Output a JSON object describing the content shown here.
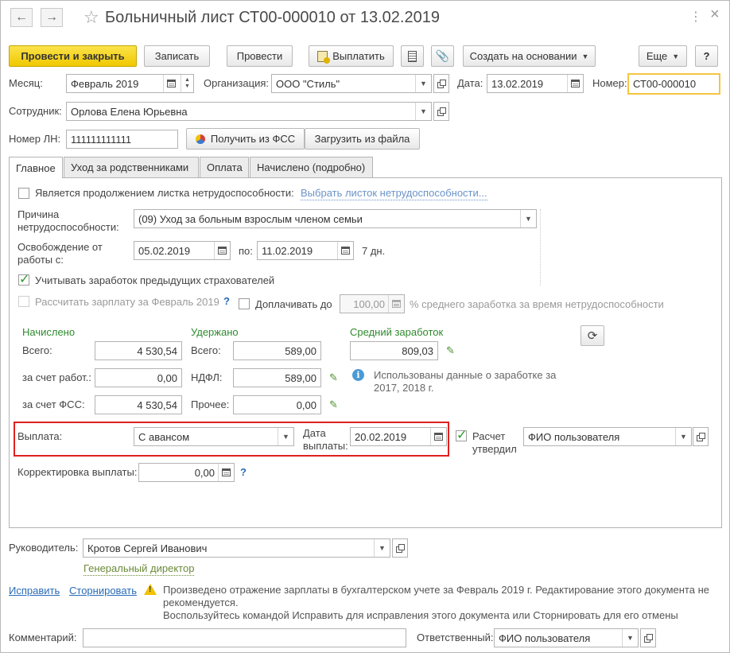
{
  "title": {
    "back": "←",
    "forward": "→",
    "star": "☆",
    "text": "Больничный лист СТ00-000010 от 13.02.2019",
    "more": "⋮",
    "close": "×"
  },
  "toolbar": {
    "post_close": "Провести и закрыть",
    "write": "Записать",
    "post": "Провести",
    "pay": "Выплатить",
    "create_based": "Создать на основании",
    "more": "Еще",
    "help": "?"
  },
  "header": {
    "month_label": "Месяц:",
    "month_value": "Февраль 2019",
    "org_label": "Организация:",
    "org_value": "ООО \"Стиль\"",
    "date_label": "Дата:",
    "date_value": "13.02.2019",
    "number_label": "Номер:",
    "number_value": "СТ00-000010",
    "employee_label": "Сотрудник:",
    "employee_value": "Орлова Елена Юрьевна",
    "ln_label": "Номер ЛН:",
    "ln_value": "111111111111",
    "get_fss": "Получить из ФСС",
    "load_file": "Загрузить из файла"
  },
  "tabs": [
    {
      "label": "Главное",
      "active": true
    },
    {
      "label": "Уход за родственниками",
      "active": false
    },
    {
      "label": "Оплата",
      "active": false
    },
    {
      "label": "Начислено (подробно)",
      "active": false
    }
  ],
  "main": {
    "continuation_label": "Является продолжением листка нетрудоспособности:",
    "continuation_checked": false,
    "choose_sheet_link": "Выбрать листок нетрудоспособности...",
    "reason_label_1": "Причина",
    "reason_label_2": "нетрудоспособности:",
    "reason_value": "(09) Уход за больным взрослым членом семьи",
    "release_label_1": "Освобождение от",
    "release_label_2": "работы с:",
    "release_from": "05.02.2019",
    "release_to_label": "по:",
    "release_to": "11.02.2019",
    "days": "7 дн.",
    "prev_insurers_label": "Учитывать заработок предыдущих страхователей",
    "prev_insurers_checked": true,
    "calc_salary_label": "Рассчитать зарплату за Февраль 2019",
    "calc_salary_checked": false,
    "calc_salary_q": "?",
    "surcharge_label": "Доплачивать до",
    "surcharge_checked": false,
    "surcharge_value": "100,00",
    "surcharge_suffix": "% среднего заработка за время нетрудоспособности"
  },
  "accrued": {
    "header": "Начислено",
    "total_label": "Всего:",
    "total": "4 530,54",
    "employer_label": "за счет работ.:",
    "employer": "0,00",
    "fss_label": "за счет ФСС:",
    "fss": "4 530,54"
  },
  "withheld": {
    "header": "Удержано",
    "total_label": "Всего:",
    "total": "589,00",
    "ndfl_label": "НДФЛ:",
    "ndfl": "589,00",
    "other_label": "Прочее:",
    "other": "0,00"
  },
  "average": {
    "header": "Средний заработок",
    "value": "809,03",
    "info_line_1": "Использованы данные о заработке за",
    "info_line_2": "2017,  2018 г."
  },
  "payment": {
    "label": "Выплата:",
    "value": "С авансом",
    "date_label_1": "Дата",
    "date_label_2": "выплаты:",
    "date_value": "20.02.2019",
    "approved_label_1": "Расчет",
    "approved_label_2": "утвердил",
    "approved_checked": true,
    "approver": "ФИО пользователя",
    "correction_label": "Корректировка выплаты:",
    "correction_value": "0,00",
    "correction_q": "?"
  },
  "footer": {
    "head_label": "Руководитель:",
    "head_value": "Кротов Сергей Иванович",
    "head_position": "Генеральный директор",
    "fix_link": "Исправить",
    "storno_link": "Сторнировать",
    "warning_line_1": "Произведено отражение зарплаты в бухгалтерском учете за Февраль 2019 г. Редактирование этого документа не",
    "warning_line_2": "рекомендуется.",
    "warning_line_3": "Воспользуйтесь командой Исправить для исправления этого документа или Сторнировать для его отмены",
    "comment_label": "Комментарий:",
    "comment_value": "",
    "responsible_label": "Ответственный:",
    "responsible_value": "ФИО пользователя"
  },
  "colors": {
    "primary_button": "#f0c800",
    "green_header": "#2f8a2f",
    "link": "#2a6bb8",
    "highlight_box": "#e02020",
    "focus_border": "#f5c542"
  }
}
